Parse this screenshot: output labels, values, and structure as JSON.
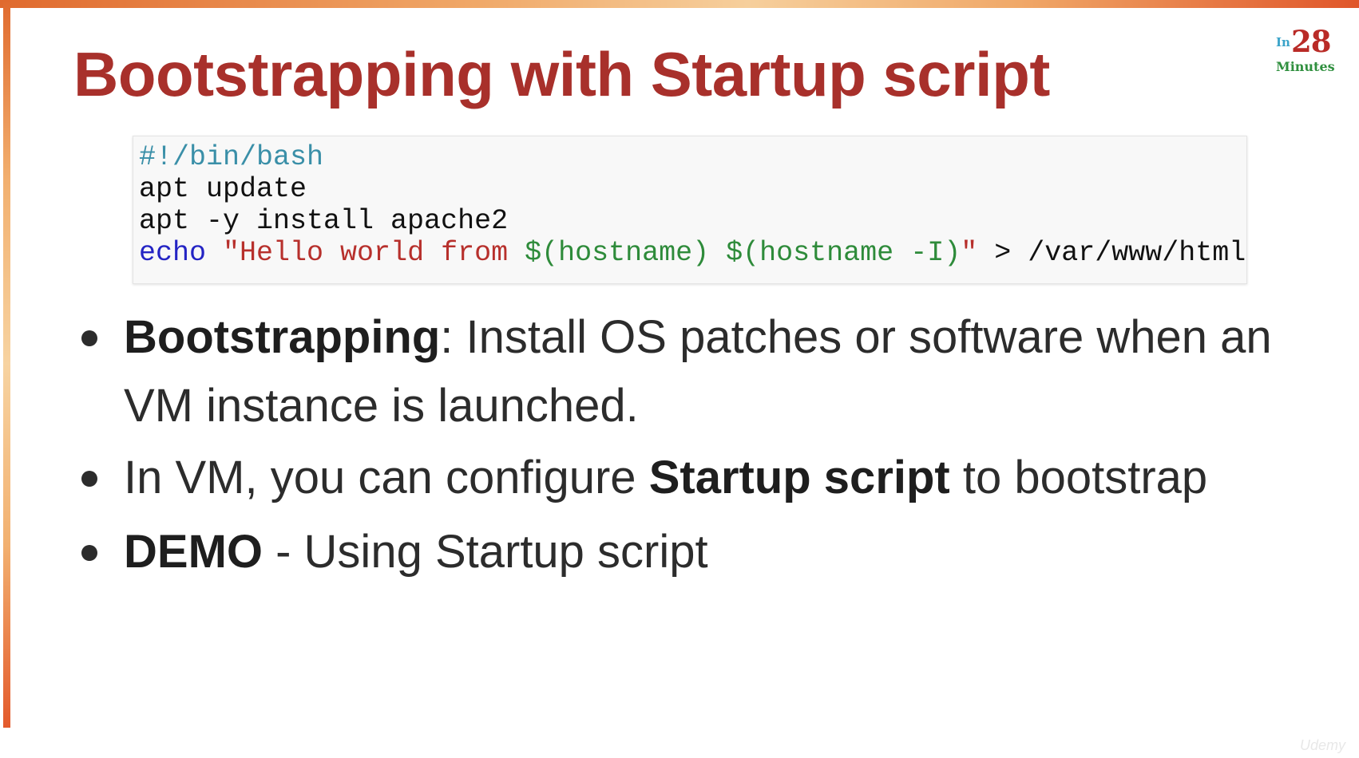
{
  "slide": {
    "title": "Bootstrapping with Startup script"
  },
  "logo": {
    "in": "In",
    "number": "28",
    "minutes": "Minutes"
  },
  "code": {
    "line1": "#!/bin/bash",
    "line2": "apt update",
    "line3": "apt -y install apache2",
    "line4_echo": "echo",
    "line4_string_open": "\"Hello world from ",
    "line4_var1": "$(hostname)",
    "line4_space": " ",
    "line4_var2": "$(hostname -I)",
    "line4_string_close": "\"",
    "line4_redirect": " > /var/www/html/index.html"
  },
  "bullets": {
    "b1_bold": "Bootstrapping",
    "b1_rest": ": Install OS patches or software when an VM instance is launched.",
    "b2_pre": "In VM, you can configure ",
    "b2_bold": "Startup script",
    "b2_post": " to bootstrap",
    "b3_bold": "DEMO",
    "b3_rest": " - Using Startup script"
  },
  "watermark": "Udemy",
  "colors": {
    "title": "#a8302b",
    "accent_bar": "#e06a2e",
    "code_comment": "#3a8fa8",
    "code_keyword": "#2424c4",
    "code_string": "#b7302c",
    "code_variable": "#2e8b3a"
  }
}
